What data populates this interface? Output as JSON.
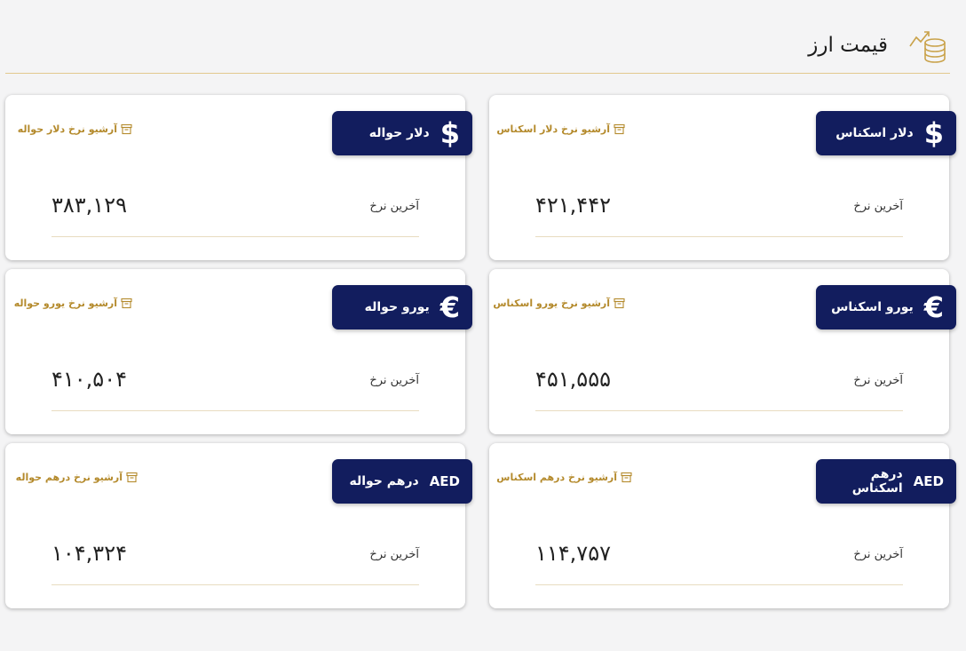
{
  "header": {
    "title": "قیمت ارز"
  },
  "cards": [
    {
      "label": "دلار اسکناس",
      "symbol": "$",
      "archive": "آرشیو نرخ دلار اسکناس",
      "last_label": "آخرین نرخ",
      "rate": "۴۲۱,۴۴۲"
    },
    {
      "label": "دلار حواله",
      "symbol": "$",
      "archive": "آرشیو نرخ دلار حواله",
      "last_label": "آخرین نرخ",
      "rate": "۳۸۳,۱۲۹"
    },
    {
      "label": "یورو اسکناس",
      "symbol": "€",
      "archive": "آرشیو نرخ یورو اسکناس",
      "last_label": "آخرین نرخ",
      "rate": "۴۵۱,۵۵۵"
    },
    {
      "label": "یورو حواله",
      "symbol": "€",
      "archive": "آرشیو نرخ یورو حواله",
      "last_label": "آخرین نرخ",
      "rate": "۴۱۰,۵۰۴"
    },
    {
      "label": "درهم اسکناس",
      "symbol": "AED",
      "archive": "آرشیو نرخ درهم اسکناس",
      "last_label": "آخرین نرخ",
      "rate": "۱۱۴,۷۵۷"
    },
    {
      "label": "درهم حواله",
      "symbol": "AED",
      "archive": "آرشیو نرخ درهم حواله",
      "last_label": "آخرین نرخ",
      "rate": "۱۰۴,۳۲۴"
    }
  ],
  "colors": {
    "badge": "#121d5e",
    "accent": "#b48a2c",
    "background": "#f4f4f5"
  },
  "icons": {
    "header": "coins-trend-icon",
    "archive": "archive-box-icon"
  }
}
